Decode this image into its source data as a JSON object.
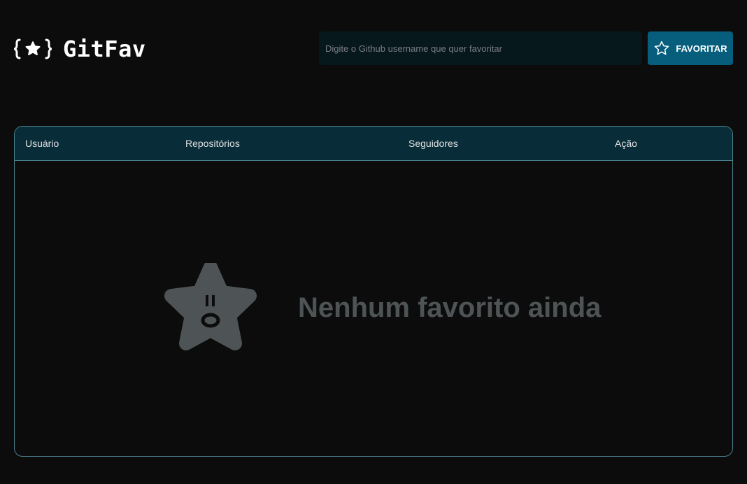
{
  "header": {
    "brand": "GitFav",
    "logo_icon": "curly-braces-star-icon"
  },
  "search": {
    "placeholder": "Digite o Github username que quer favoritar",
    "value": ""
  },
  "favorite_button": {
    "label": "FAVORITAR",
    "icon": "star-outline-icon"
  },
  "table": {
    "columns": [
      "Usuário",
      "Repositórios",
      "Seguidores",
      "Ação"
    ],
    "rows": []
  },
  "empty_state": {
    "icon": "surprised-star-icon",
    "message": "Nenhum favorito ainda"
  },
  "colors": {
    "background": "#0c0c0c",
    "input_background": "#06181c",
    "button": "#065e7c",
    "table_header": "#092d38",
    "table_border": "#4a808c",
    "empty_text": "#4e5455"
  }
}
